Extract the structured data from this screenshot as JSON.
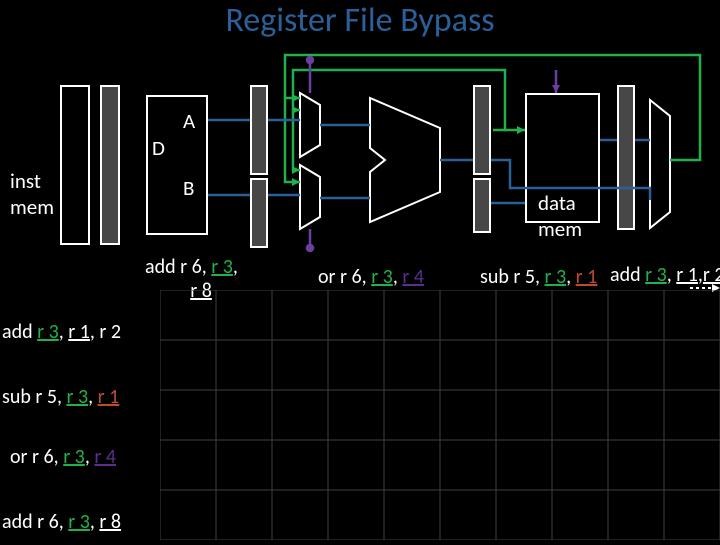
{
  "title": "Register File Bypass",
  "blocks": {
    "inst_mem": "inst\nmem",
    "data_mem": "data\nmem",
    "port_a": "A",
    "port_b": "B",
    "port_d": "D"
  },
  "pipeline_labels": [
    "add r 6, r 3, r 8",
    "or r 6, r 3, r 4",
    "sub r 5, r 3, r 1",
    "add r 3, r 1, r 2"
  ],
  "program": [
    "add r 3, r 1, r 2",
    "sub r 5, r 3, r 1",
    "or r 6, r 3, r 4",
    "add r 6, r 3, r 8"
  ],
  "colors": {
    "bg": "#000000",
    "wire_forward": "#1fb14c",
    "wire_blue": "#2a6099",
    "wire_purple": "#5b2e8f",
    "title": "#2a6099"
  }
}
